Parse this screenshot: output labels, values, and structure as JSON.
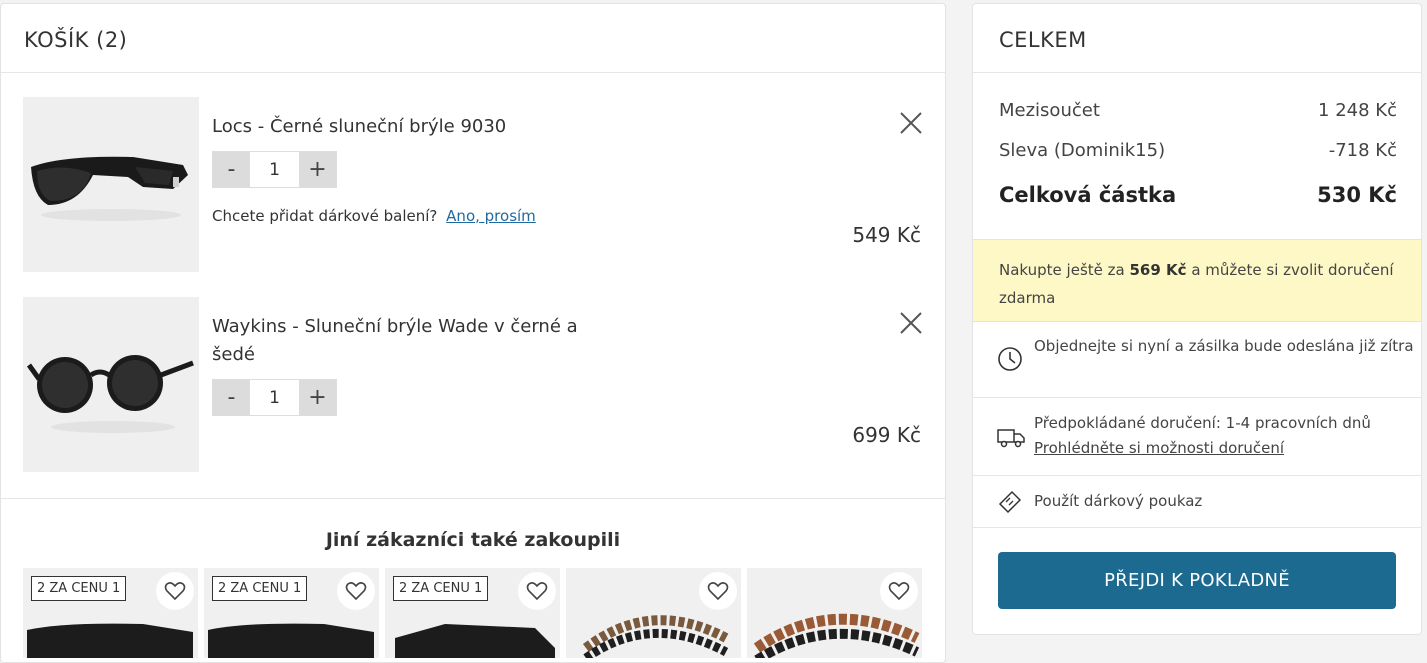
{
  "cart": {
    "title": "KOŠÍK (2)",
    "items": [
      {
        "name": "Locs - Černé sluneční brýle 9030",
        "qty": "1",
        "minus": "-",
        "plus": "+",
        "gift_question": "Chcete přidat dárkové balení?",
        "gift_link": "Ano, prosím",
        "price": "549 Kč"
      },
      {
        "name": "Waykins - Sluneční brýle Wade v černé a šedé",
        "qty": "1",
        "minus": "-",
        "plus": "+",
        "price": "699 Kč"
      }
    ],
    "reco_title": "Jiní zákazníci také zakoupili",
    "reco_badges": [
      "2 ZA CENU 1",
      "2 ZA CENU 1",
      "2 ZA CENU 1"
    ]
  },
  "summary": {
    "title": "CELKEM",
    "subtotal_label": "Mezisoučet",
    "subtotal_value": "1 248 Kč",
    "discount_label": "Sleva (Dominik15)",
    "discount_value": "-718 Kč",
    "total_label": "Celková částka",
    "total_value": "530 Kč",
    "promo_pre": "Nakupte ještě za",
    "promo_amount": "569 Kč",
    "promo_post": "a můžete si zvolit doručení zdarma",
    "ship_today": "Objednejte si nyní a zásilka bude odeslána již zítra",
    "delivery_time": "Předpokládané doručení: 1-4 pracovních dnů",
    "delivery_link": "Prohlédněte si možnosti doručení",
    "voucher": "Použít dárkový poukaz",
    "checkout": "PŘEJDI K POKLADNĚ"
  },
  "colors": {
    "accent": "#1d6a90",
    "promo_bg": "#fdf8c6",
    "link": "#1f6aa0"
  }
}
